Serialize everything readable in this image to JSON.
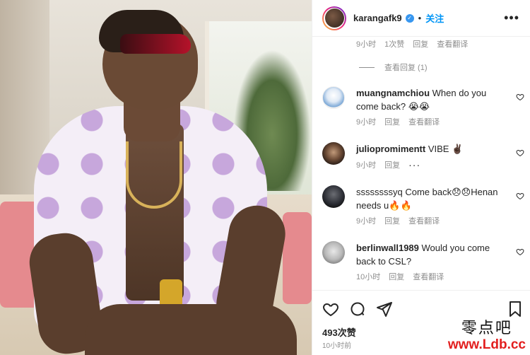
{
  "post": {
    "username": "karangafk9",
    "follow_label": "关注",
    "likes": "493次赞",
    "time": "10小时前"
  },
  "top_meta": {
    "time": "9小时",
    "likes": "1次赞",
    "reply": "回复",
    "translate": "查看翻译"
  },
  "view_replies": "查看回复 (1)",
  "comments": [
    {
      "user": "muangnamchiou",
      "text": "When do you come back? 😭😭",
      "time": "9小时",
      "reply": "回复",
      "translate": "查看翻译"
    },
    {
      "user": "juliopromimentt",
      "text": "VIBE ✌🏿",
      "time": "9小时",
      "reply": "回复"
    },
    {
      "user": "ssssssssyq",
      "text": "Come back😞😞Henan needs u🔥🔥",
      "time": "9小时",
      "reply": "回复",
      "translate": "查看翻译"
    },
    {
      "user": "berlinwall1989",
      "text": "Would you come back to CSL?",
      "time": "10小时",
      "reply": "回复",
      "translate": "查看翻译"
    }
  ],
  "watermark": {
    "name": "零点吧",
    "url": "www.Ldb.cc"
  },
  "colors": {
    "link": "#0095f6",
    "muted": "#8e8e8e",
    "text": "#262626",
    "watermark_url": "#e21e1e"
  }
}
